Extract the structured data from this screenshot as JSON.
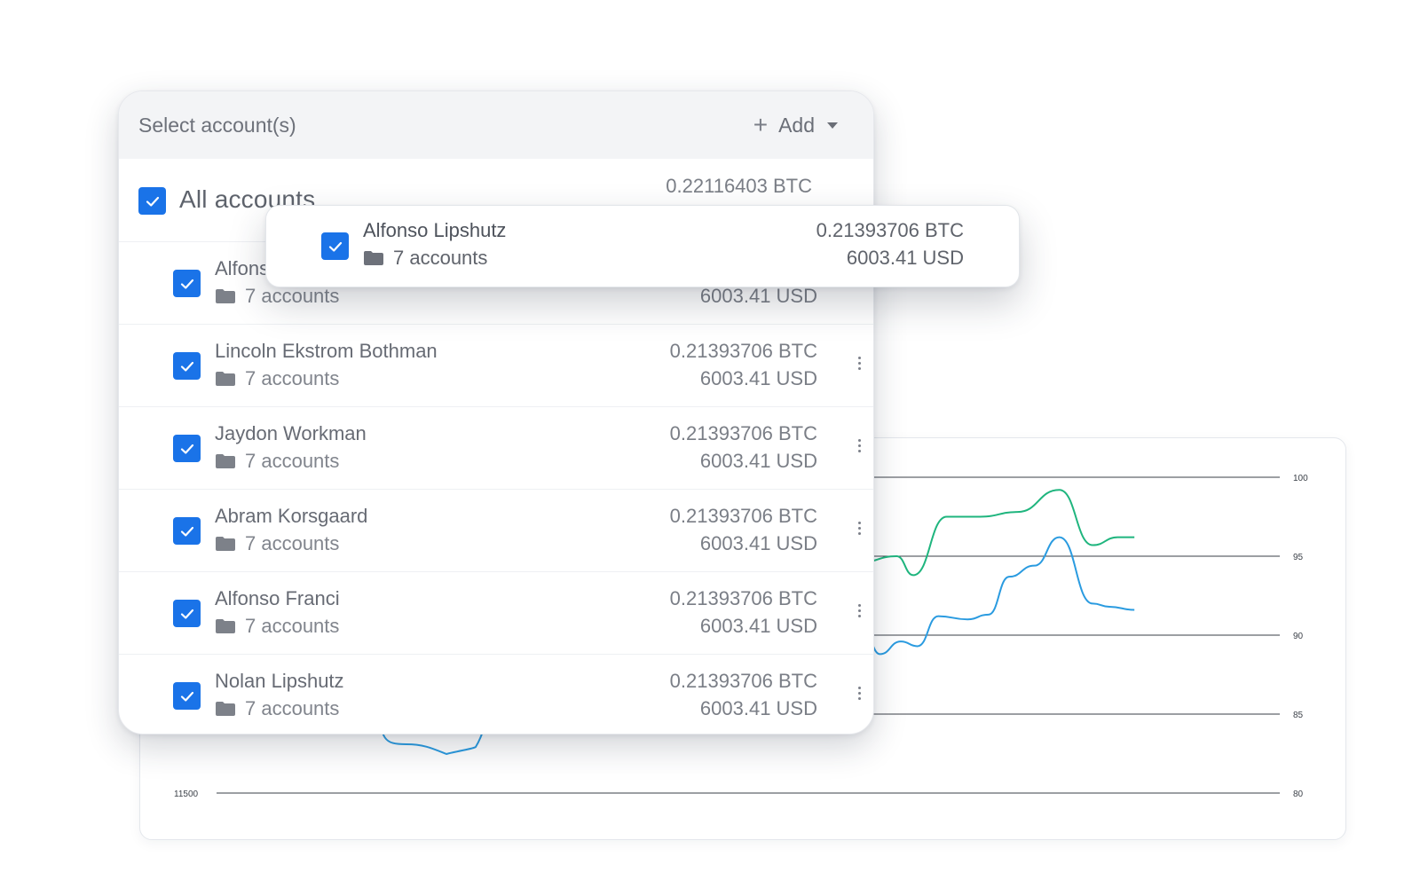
{
  "panel": {
    "title": "Select account(s)",
    "add_label": "Add",
    "all": {
      "label": "All accounts",
      "btc": "0.22116403 BTC"
    },
    "rows": [
      {
        "name": "Alfonso Lipshutz",
        "sub": "7 accounts",
        "btc": "0.21393706 BTC",
        "usd": "6003.41 USD"
      },
      {
        "name": "Lincoln Ekstrom Bothman",
        "sub": "7 accounts",
        "btc": "0.21393706 BTC",
        "usd": "6003.41 USD"
      },
      {
        "name": "Jaydon Workman",
        "sub": "7 accounts",
        "btc": "0.21393706 BTC",
        "usd": "6003.41 USD"
      },
      {
        "name": "Abram Korsgaard",
        "sub": "7 accounts",
        "btc": "0.21393706 BTC",
        "usd": "6003.41 USD"
      },
      {
        "name": "Alfonso Franci",
        "sub": "7 accounts",
        "btc": "0.21393706 BTC",
        "usd": "6003.41 USD"
      },
      {
        "name": "Nolan Lipshutz",
        "sub": "7 accounts",
        "btc": "0.21393706 BTC",
        "usd": "6003.41 USD"
      }
    ]
  },
  "floating_card": {
    "name": "Alfonso Lipshutz",
    "sub": "7 accounts",
    "btc": "0.21393706 BTC",
    "usd": "6003.41 USD"
  },
  "icons": {
    "checkbox": "checkmark-icon",
    "folder": "folder-icon",
    "add": "plus-icon",
    "dropdown": "caret-down-icon",
    "menu": "kebab-menu-icon"
  },
  "colors": {
    "checkbox": "#1a73e8",
    "line_green": "#1fb57e",
    "line_blue": "#2a9be0"
  },
  "chart_data": {
    "type": "line",
    "left_axis": {
      "ticks": [
        11500
      ]
    },
    "right_axis": {
      "ticks": [
        100,
        95,
        90,
        85,
        80
      ],
      "ylim": [
        80,
        100
      ]
    },
    "series": [
      {
        "color": "#1fb57e",
        "x": [
          0.0,
          0.09,
          0.13,
          0.21,
          0.29,
          0.38,
          0.48,
          0.56,
          0.62,
          0.66
        ],
        "y": [
          94.6,
          95.0,
          93.8,
          97.5,
          97.5,
          97.8,
          99.2,
          95.7,
          96.2,
          96.2
        ]
      },
      {
        "color": "#2a9be0",
        "x": [
          0.0,
          0.05,
          0.1,
          0.14,
          0.19,
          0.26,
          0.31,
          0.36,
          0.42,
          0.48,
          0.56,
          0.6,
          0.66
        ],
        "y": [
          91.5,
          88.8,
          89.6,
          89.3,
          91.2,
          91.0,
          91.3,
          93.7,
          94.4,
          96.2,
          92.0,
          91.8,
          91.6
        ]
      }
    ]
  }
}
